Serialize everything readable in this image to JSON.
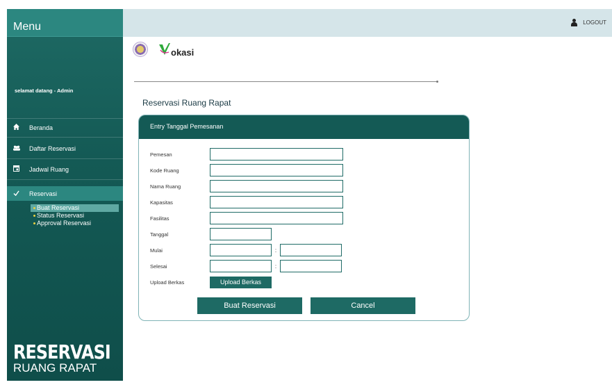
{
  "sidebar": {
    "menu_title": "Menu",
    "welcome": "selamat datang - Admin",
    "items": [
      {
        "label": "Beranda",
        "icon": "home-icon"
      },
      {
        "label": "Daftar Reservasi",
        "icon": "users-icon"
      },
      {
        "label": "Jadwal Ruang",
        "icon": "calendar-icon"
      },
      {
        "label": "Reservasi",
        "icon": "check-icon"
      }
    ],
    "sub_items": [
      {
        "label": "Buat Reservasi",
        "active": true
      },
      {
        "label": "Status Reservasi",
        "active": false
      },
      {
        "label": "Approval Reservasi",
        "active": false
      }
    ],
    "brand_line1": "RESERVASI",
    "brand_line2": "RUANG RAPAT"
  },
  "header": {
    "logout_label": "LOGOUT",
    "logo_text": "okasi"
  },
  "main": {
    "title": "Reservasi Ruang Rapat",
    "form": {
      "header": "Entry Tanggal Pemesanan",
      "fields": {
        "pemesan": {
          "label": "Pemesan",
          "value": ""
        },
        "kode_ruang": {
          "label": "Kode Ruang",
          "value": ""
        },
        "nama_ruang": {
          "label": "Nama Ruang",
          "value": ""
        },
        "kapasitas": {
          "label": "Kapasitas",
          "value": ""
        },
        "fasilitas": {
          "label": "Fasilitas",
          "value": ""
        },
        "tanggal": {
          "label": "Tanggal",
          "value": ""
        },
        "mulai": {
          "label": "Mulai",
          "separator": ":",
          "hour": "",
          "minute": ""
        },
        "selesai": {
          "label": "Selesai",
          "separator": ":",
          "hour": "",
          "minute": ""
        },
        "upload": {
          "label": "Upload Berkas",
          "button": "Upload Berkas"
        }
      },
      "submit_label": "Buat Reservasi",
      "cancel_label": "Cancel"
    }
  },
  "colors": {
    "sidebar_bg": "#145a55",
    "accent": "#1e6a64",
    "topbar_bg": "#d5e5e9"
  }
}
